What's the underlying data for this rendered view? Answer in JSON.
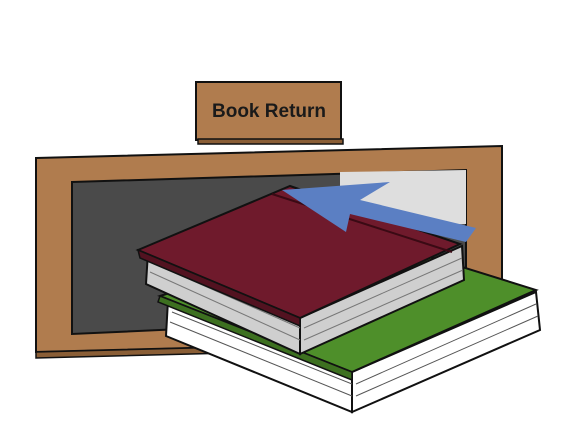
{
  "sign": {
    "text": "Book Return"
  },
  "colors": {
    "wood": "#b07c4e",
    "slot_dark": "#4a4a4a",
    "slot_light": "#dedede",
    "red_book_cover": "#6f1a2c",
    "green_book_cover": "#4e8f2a",
    "pages": "#cfcfcf",
    "arrow": "#5b7fc3",
    "outline": "#111111"
  },
  "icons": {
    "arrow": "insert-arrow-icon"
  }
}
